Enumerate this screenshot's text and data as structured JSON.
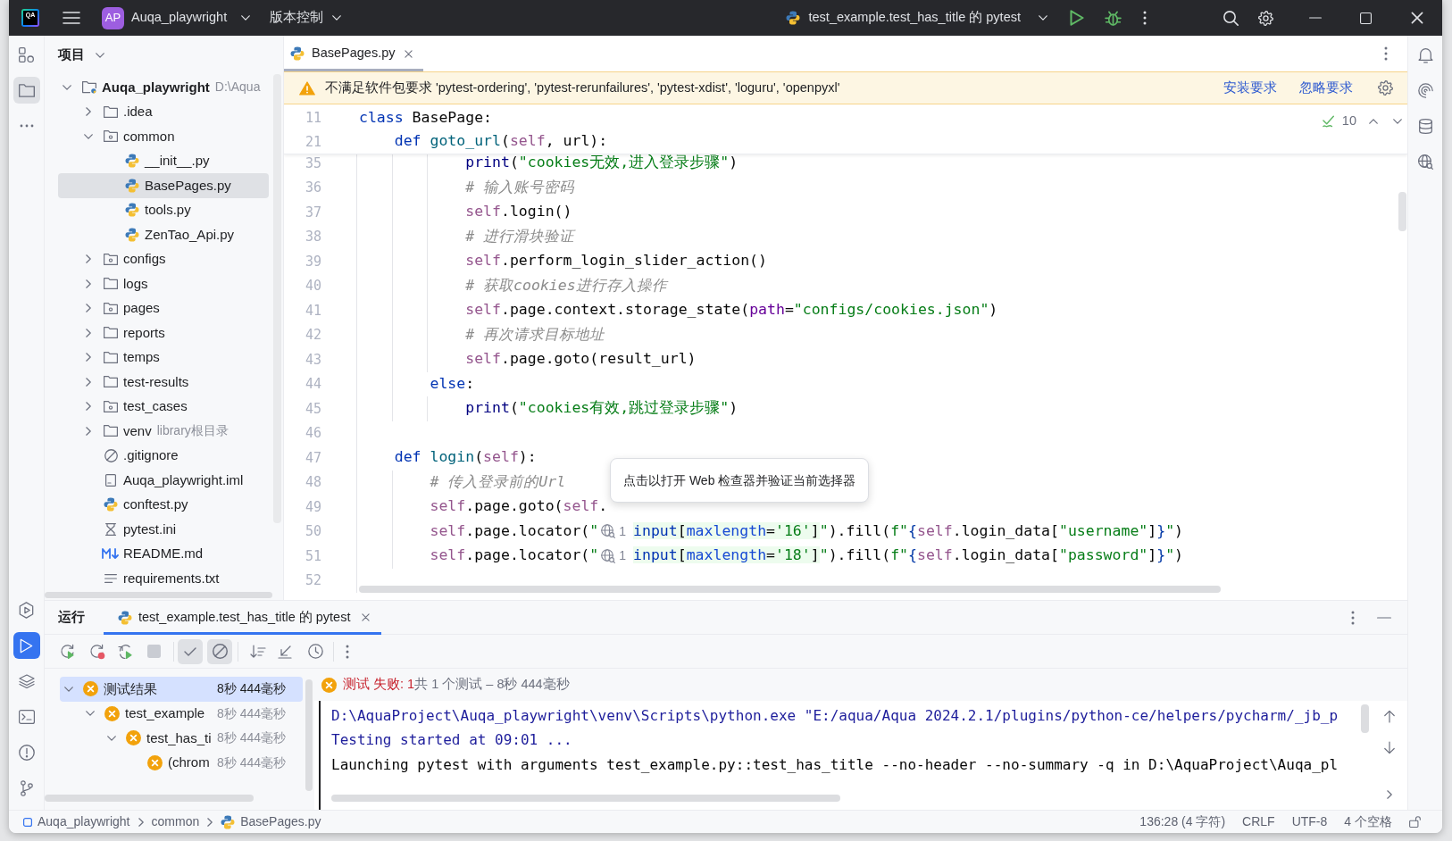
{
  "title_bar": {
    "logo_text": "QA",
    "project_badge": "AP",
    "project_name": "Auqa_playwright",
    "vcs_menu": "版本控制",
    "run_config": "test_example.test_has_title 的 pytest"
  },
  "left_toolbar": {
    "top": [
      {
        "kind": "structure",
        "selected": false
      },
      {
        "kind": "project",
        "selected": true
      },
      {
        "kind": "more",
        "selected": false
      }
    ],
    "bottom": [
      {
        "kind": "services",
        "selected": false
      },
      {
        "kind": "run",
        "selected": true
      },
      {
        "kind": "packages",
        "selected": false
      },
      {
        "kind": "terminal",
        "selected": false
      },
      {
        "kind": "problems",
        "selected": false
      },
      {
        "kind": "git",
        "selected": false
      }
    ]
  },
  "project_panel": {
    "title": "项目",
    "tree": [
      {
        "kind": "project",
        "label": "Auqa_playwright",
        "hint": "D:\\Aqua",
        "expanded": true,
        "selected": false,
        "children": [
          {
            "kind": "folder",
            "label": ".idea",
            "expanded": false,
            "selected": false
          },
          {
            "kind": "package",
            "label": "common",
            "expanded": true,
            "selected": false,
            "children": [
              {
                "kind": "python",
                "label": "__init__.py",
                "selected": false
              },
              {
                "kind": "python",
                "label": "BasePages.py",
                "selected": true
              },
              {
                "kind": "python",
                "label": "tools.py",
                "selected": false
              },
              {
                "kind": "python",
                "label": "ZenTao_Api.py",
                "selected": false
              }
            ]
          },
          {
            "kind": "package",
            "label": "configs",
            "expanded": false,
            "selected": false
          },
          {
            "kind": "folder",
            "label": "logs",
            "expanded": false,
            "selected": false
          },
          {
            "kind": "package",
            "label": "pages",
            "expanded": false,
            "selected": false
          },
          {
            "kind": "folder",
            "label": "reports",
            "expanded": false,
            "selected": false
          },
          {
            "kind": "folder",
            "label": "temps",
            "expanded": false,
            "selected": false
          },
          {
            "kind": "folder",
            "label": "test-results",
            "expanded": false,
            "selected": false
          },
          {
            "kind": "package",
            "label": "test_cases",
            "expanded": false,
            "selected": false
          },
          {
            "kind": "folder",
            "label": "venv",
            "hint": "library根目录",
            "expanded": false,
            "selected": false
          },
          {
            "kind": "ignore",
            "label": ".gitignore",
            "selected": false
          },
          {
            "kind": "iml",
            "label": "Auqa_playwright.iml",
            "selected": false
          },
          {
            "kind": "python",
            "label": "conftest.py",
            "selected": false
          },
          {
            "kind": "ini",
            "label": "pytest.ini",
            "selected": false
          },
          {
            "kind": "markdown",
            "label": "README.md",
            "selected": false
          },
          {
            "kind": "text",
            "label": "requirements.txt",
            "selected": false
          }
        ]
      }
    ]
  },
  "editor": {
    "tabs": [
      {
        "label": "BasePages.py",
        "selected": true
      }
    ],
    "banner": {
      "message": "不满足软件包要求 'pytest-ordering', 'pytest-rerunfailures', 'pytest-xdist', 'loguru', 'openpyxl'",
      "actions": [
        "安装要求",
        "忽略要求"
      ]
    },
    "inspection_count": "10",
    "sticky_lines": [
      {
        "number": "11",
        "tokens": [
          {
            "kind": "kw",
            "text": "class"
          },
          {
            "kind": "p",
            "text": " BasePage:"
          }
        ]
      },
      {
        "number": "21",
        "tokens": [
          {
            "kind": "kw",
            "text": "    def "
          },
          {
            "kind": "fn",
            "text": "goto_url"
          },
          {
            "kind": "p",
            "text": "("
          },
          {
            "kind": "self",
            "text": "self"
          },
          {
            "kind": "p",
            "text": ", url):"
          }
        ]
      }
    ],
    "lines": [
      {
        "number": "35",
        "tokens": [
          {
            "kind": "bi",
            "text": "            print"
          },
          {
            "kind": "p",
            "text": "("
          },
          {
            "kind": "str",
            "text": "\"cookies无效,进入登录步骤\""
          },
          {
            "kind": "p",
            "text": ")"
          }
        ]
      },
      {
        "number": "36",
        "tokens": [
          {
            "kind": "cm",
            "text": "            # 输入账号密码"
          }
        ]
      },
      {
        "number": "37",
        "tokens": [
          {
            "kind": "self",
            "text": "            self"
          },
          {
            "kind": "p",
            "text": ".login()"
          }
        ]
      },
      {
        "number": "38",
        "tokens": [
          {
            "kind": "cm",
            "text": "            # 进行滑块验证"
          }
        ]
      },
      {
        "number": "39",
        "tokens": [
          {
            "kind": "self",
            "text": "            self"
          },
          {
            "kind": "p",
            "text": ".perform_login_slider_action()"
          }
        ]
      },
      {
        "number": "40",
        "tokens": [
          {
            "kind": "cm",
            "text": "            # 获取cookies进行存入操作"
          }
        ]
      },
      {
        "number": "41",
        "tokens": [
          {
            "kind": "self",
            "text": "            self"
          },
          {
            "kind": "p",
            "text": ".page.context.storage_state("
          },
          {
            "kind": "prm",
            "text": "path"
          },
          {
            "kind": "p",
            "text": "="
          },
          {
            "kind": "str",
            "text": "\"configs/cookies.json\""
          },
          {
            "kind": "p",
            "text": ")"
          }
        ]
      },
      {
        "number": "42",
        "tokens": [
          {
            "kind": "cm",
            "text": "            # 再次请求目标地址"
          }
        ]
      },
      {
        "number": "43",
        "tokens": [
          {
            "kind": "self",
            "text": "            self"
          },
          {
            "kind": "p",
            "text": ".page.goto(result_url)"
          }
        ]
      },
      {
        "number": "44",
        "tokens": [
          {
            "kind": "kw",
            "text": "        else"
          },
          {
            "kind": "p",
            "text": ":"
          }
        ]
      },
      {
        "number": "45",
        "tokens": [
          {
            "kind": "bi",
            "text": "            print"
          },
          {
            "kind": "p",
            "text": "("
          },
          {
            "kind": "str",
            "text": "\"cookies有效,跳过登录步骤\""
          },
          {
            "kind": "p",
            "text": ")"
          }
        ]
      },
      {
        "number": "46"
      },
      {
        "number": "47",
        "tokens": [
          {
            "kind": "kw",
            "text": "    def "
          },
          {
            "kind": "fn",
            "text": "login"
          },
          {
            "kind": "p",
            "text": "("
          },
          {
            "kind": "self",
            "text": "self"
          },
          {
            "kind": "p",
            "text": "):"
          }
        ]
      },
      {
        "number": "48",
        "tokens": [
          {
            "kind": "cm",
            "text": "        # 传入登录前的Url"
          }
        ]
      },
      {
        "number": "49",
        "tokens": [
          {
            "kind": "self",
            "text": "        self"
          },
          {
            "kind": "p",
            "text": ".page.goto("
          },
          {
            "kind": "self",
            "text": "self"
          },
          {
            "kind": "p",
            "text": "."
          }
        ]
      },
      {
        "number": "50",
        "tokens": [
          {
            "kind": "self",
            "text": "        self"
          },
          {
            "kind": "p",
            "text": ".page.locator("
          },
          {
            "kind": "str",
            "text": "\""
          },
          {
            "kind": "inlay",
            "text": "1"
          },
          {
            "kind": "ftag",
            "text": "input"
          },
          {
            "kind": "fp",
            "text": "["
          },
          {
            "kind": "fattr",
            "text": "maxlength"
          },
          {
            "kind": "fp",
            "text": "="
          },
          {
            "kind": "fstr",
            "text": "'16'"
          },
          {
            "kind": "fp",
            "text": "]"
          },
          {
            "kind": "str",
            "text": "\""
          },
          {
            "kind": "p",
            "text": ").fill("
          },
          {
            "kind": "str",
            "text": "f\""
          },
          {
            "kind": "brace",
            "text": "{"
          },
          {
            "kind": "self",
            "text": "self"
          },
          {
            "kind": "p",
            "text": ".login_data["
          },
          {
            "kind": "str",
            "text": "\"username\""
          },
          {
            "kind": "p",
            "text": "]"
          },
          {
            "kind": "brace",
            "text": "}"
          },
          {
            "kind": "str",
            "text": "\""
          },
          {
            "kind": "p",
            "text": ")"
          }
        ]
      },
      {
        "number": "51",
        "tokens": [
          {
            "kind": "self",
            "text": "        self"
          },
          {
            "kind": "p",
            "text": ".page.locator("
          },
          {
            "kind": "str",
            "text": "\""
          },
          {
            "kind": "inlay",
            "text": "1"
          },
          {
            "kind": "ftag",
            "text": "input"
          },
          {
            "kind": "fp",
            "text": "["
          },
          {
            "kind": "fattr",
            "text": "maxlength"
          },
          {
            "kind": "fp",
            "text": "="
          },
          {
            "kind": "fstr",
            "text": "'18'"
          },
          {
            "kind": "fp",
            "text": "]"
          },
          {
            "kind": "str",
            "text": "\""
          },
          {
            "kind": "p",
            "text": ").fill("
          },
          {
            "kind": "str",
            "text": "f\""
          },
          {
            "kind": "brace",
            "text": "{"
          },
          {
            "kind": "self",
            "text": "self"
          },
          {
            "kind": "p",
            "text": ".login_data["
          },
          {
            "kind": "str",
            "text": "\"password\""
          },
          {
            "kind": "p",
            "text": "]"
          },
          {
            "kind": "brace",
            "text": "}"
          },
          {
            "kind": "str",
            "text": "\""
          },
          {
            "kind": "p",
            "text": ")"
          }
        ]
      },
      {
        "number": "52"
      }
    ],
    "tooltip": "点击以打开 Web 检查器并验证当前选择器"
  },
  "right_toolbar": [
    {
      "kind": "notifications"
    },
    {
      "kind": "ai"
    },
    {
      "kind": "database"
    },
    {
      "kind": "web"
    }
  ],
  "run_panel": {
    "title": "运行",
    "tabs": [
      {
        "label": "test_example.test_has_title 的 pytest",
        "selected": true
      }
    ],
    "stop": {
      "disabled": true
    },
    "filters": [
      {
        "kind": "passed",
        "on": true
      },
      {
        "kind": "ignored",
        "on": true
      }
    ],
    "tests": [
      {
        "label": "测试结果",
        "time": "8秒 444毫秒",
        "failed": true,
        "expanded": true,
        "selected": true,
        "children": [
          {
            "label": "test_example",
            "time": "8秒 444毫秒",
            "failed": true,
            "expanded": true,
            "selected": false,
            "children": [
              {
                "label": "test_has_ti",
                "time": "8秒 444毫秒",
                "failed": true,
                "expanded": true,
                "selected": false,
                "children": [
                  {
                    "label": "(chrom",
                    "time": "8秒 444毫秒",
                    "failed": true,
                    "selected": false
                  }
                ]
              }
            ]
          }
        ]
      }
    ],
    "summary": {
      "status": "测试 失败: 1",
      "detail": "共 1 个测试 – 8秒 444毫秒"
    },
    "console": [
      {
        "kind": "system",
        "text": "D:\\AquaProject\\Auqa_playwright\\venv\\Scripts\\python.exe \"E:/aqua/Aqua 2024.2.1/plugins/python-ce/helpers/pycharm/_jb_p"
      },
      {
        "kind": "system",
        "text": "Testing started at 09:01 ..."
      },
      {
        "kind": "stdout",
        "text": "Launching pytest with arguments test_example.py::test_has_title --no-header --no-summary -q in D:\\AquaProject\\Auqa_pl"
      }
    ]
  },
  "status_bar": {
    "breadcrumbs": [
      {
        "kind": "module",
        "label": "Auqa_playwright"
      },
      {
        "kind": "folder",
        "label": "common"
      },
      {
        "kind": "python",
        "label": "BasePages.py"
      }
    ],
    "items": [
      "136:28 (4 字符)",
      "CRLF",
      "UTF-8",
      "4 个空格"
    ]
  }
}
